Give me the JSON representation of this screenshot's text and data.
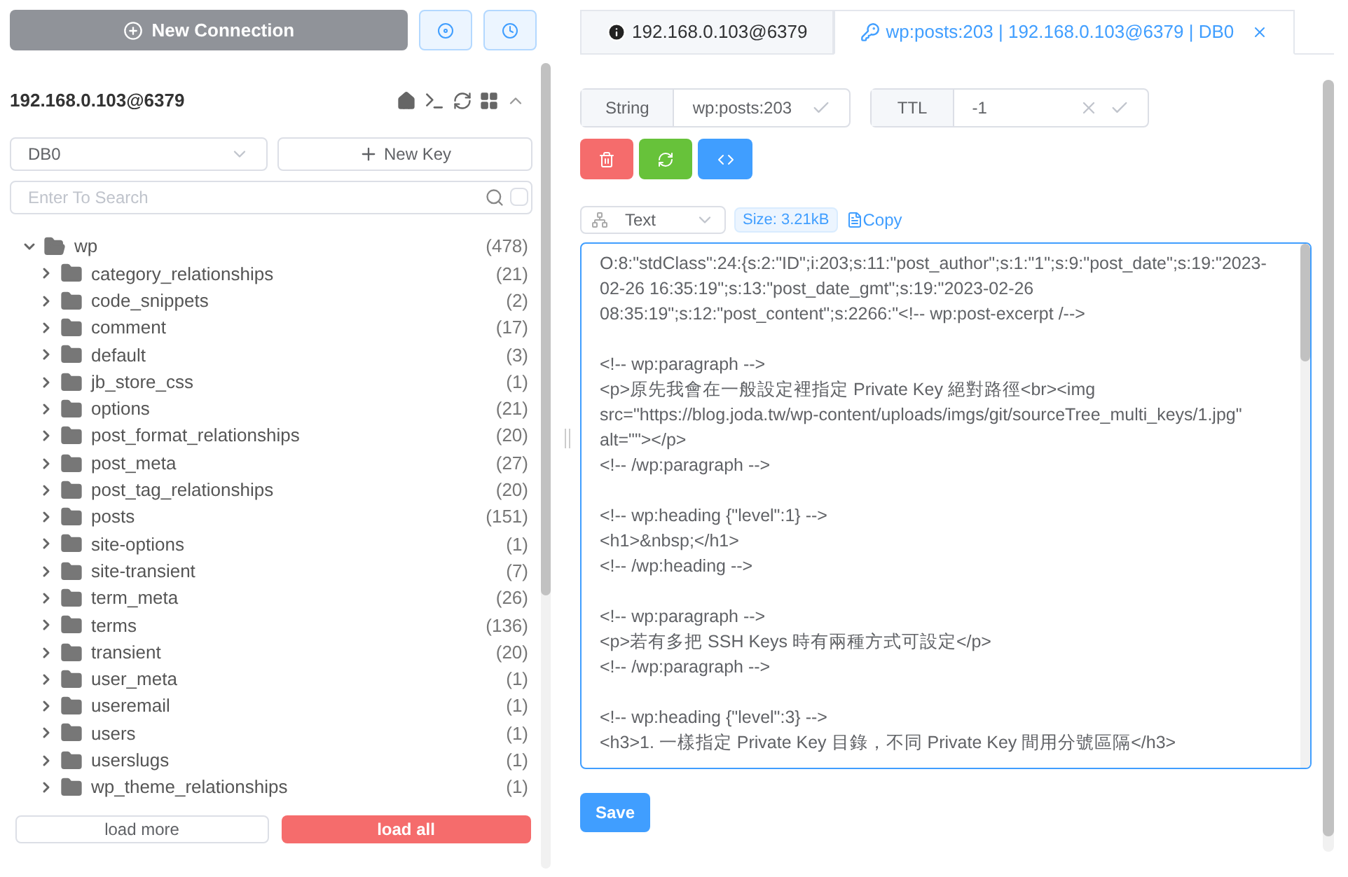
{
  "sidebar": {
    "new_connection": "New Connection",
    "connection": {
      "name": "192.168.0.103@6379",
      "expanded": true
    },
    "db_select": {
      "value": "DB0"
    },
    "new_key": "New Key",
    "search": {
      "placeholder": "Enter To Search",
      "checked": false
    },
    "tree": [
      {
        "name": "wp",
        "count": "(478)",
        "expanded": true,
        "children": [
          {
            "name": "category_relationships",
            "count": "(21)",
            "expanded": false
          },
          {
            "name": "code_snippets",
            "count": "(2)",
            "expanded": false
          },
          {
            "name": "comment",
            "count": "(17)",
            "expanded": false
          },
          {
            "name": "default",
            "count": "(3)",
            "expanded": false
          },
          {
            "name": "jb_store_css",
            "count": "(1)",
            "expanded": false
          },
          {
            "name": "options",
            "count": "(21)",
            "expanded": false
          },
          {
            "name": "post_format_relationships",
            "count": "(20)",
            "expanded": false
          },
          {
            "name": "post_meta",
            "count": "(27)",
            "expanded": false
          },
          {
            "name": "post_tag_relationships",
            "count": "(20)",
            "expanded": false
          },
          {
            "name": "posts",
            "count": "(151)",
            "expanded": false
          },
          {
            "name": "site-options",
            "count": "(1)",
            "expanded": false
          },
          {
            "name": "site-transient",
            "count": "(7)",
            "expanded": false
          },
          {
            "name": "term_meta",
            "count": "(26)",
            "expanded": false
          },
          {
            "name": "terms",
            "count": "(136)",
            "expanded": false
          },
          {
            "name": "transient",
            "count": "(20)",
            "expanded": false
          },
          {
            "name": "user_meta",
            "count": "(1)",
            "expanded": false
          },
          {
            "name": "useremail",
            "count": "(1)",
            "expanded": false
          },
          {
            "name": "users",
            "count": "(1)",
            "expanded": false
          },
          {
            "name": "userslugs",
            "count": "(1)",
            "expanded": false
          },
          {
            "name": "wp_theme_relationships",
            "count": "(1)",
            "expanded": false
          }
        ]
      }
    ],
    "load_more": "load more",
    "load_all": "load all"
  },
  "tabs": [
    {
      "kind": "info",
      "label": "192.168.0.103@6379",
      "selected": false
    },
    {
      "kind": "key",
      "label": "wp:posts:203 | 192.168.0.103@6379 | DB0",
      "selected": true
    }
  ],
  "key_bar": {
    "type": "String",
    "key": "wp:posts:203",
    "ttl_label": "TTL",
    "ttl": "-1"
  },
  "format": {
    "value": "Text",
    "size": "Size: 3.21kB",
    "copy": "Copy"
  },
  "editor": [
    [
      "O:8:\"stdClass\":24:{s:2:\"ID\";i:203;s:11:\"post_author\";s:1:\"1\";s:9:\"post_date\";s:19:\"2023-02-26 16:35:19\";s:13:\"post_date_gmt\";s:19:\"2023-02-26 08:35:19\";s:12:\"post_content\";s:2266:\"<!-- wp:post-excerpt /-->"
    ],
    [
      "<!-- wp:paragraph -->",
      "<p>原先我會在一般設定裡指定 Private Key 絕對路徑<br><img src=\"https://blog.joda.tw/wp-content/uploads/imgs/git/sourceTree_multi_keys/1.jpg\" alt=\"\"></p>",
      "<!-- /wp:paragraph -->"
    ],
    [
      "<!-- wp:heading {\"level\":1} -->",
      "<h1>&nbsp;</h1>",
      "<!-- /wp:heading -->"
    ],
    [
      "<!-- wp:paragraph -->",
      "<p>若有多把 SSH Keys 時有兩種方式可設定</p>",
      "<!-- /wp:paragraph -->"
    ],
    [
      "<!-- wp:heading {\"level\":3} -->",
      "<h3>1. 一樣指定 Private Key 目錄，不同 Private Key 間用分號區隔</h3>"
    ]
  ],
  "save": "Save"
}
